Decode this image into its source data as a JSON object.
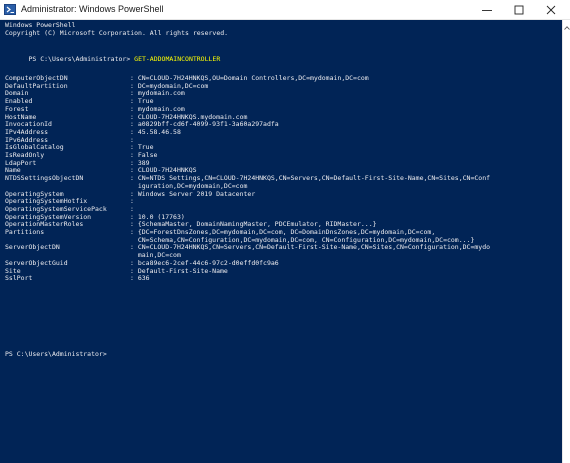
{
  "window": {
    "title": "Administrator: Windows PowerShell",
    "minimize_glyph": "—",
    "maximize_glyph": "☐",
    "close_glyph": "✕"
  },
  "console": {
    "banner_line1": "Windows PowerShell",
    "banner_line2": "Copyright (C) Microsoft Corporation. All rights reserved.",
    "prompt1": "PS C:\\Users\\Administrator> ",
    "command": "GET-ADDOMAINCONTROLLER",
    "properties": [
      {
        "key": "ComputerObjectDN",
        "value": ": CN=CLOUD-7H24HNKQS,OU=Domain Controllers,DC=mydomain,DC=com"
      },
      {
        "key": "DefaultPartition",
        "value": ": DC=mydomain,DC=com"
      },
      {
        "key": "Domain",
        "value": ": mydomain.com"
      },
      {
        "key": "Enabled",
        "value": ": True"
      },
      {
        "key": "Forest",
        "value": ": mydomain.com"
      },
      {
        "key": "HostName",
        "value": ": CLOUD-7H24HNKQS.mydomain.com"
      },
      {
        "key": "InvocationId",
        "value": ": a0829bff-cd6f-4099-93f1-3a60a297adfa"
      },
      {
        "key": "IPv4Address",
        "value": ": 45.58.46.58"
      },
      {
        "key": "IPv6Address",
        "value": ":"
      },
      {
        "key": "IsGlobalCatalog",
        "value": ": True"
      },
      {
        "key": "IsReadOnly",
        "value": ": False"
      },
      {
        "key": "LdapPort",
        "value": ": 389"
      },
      {
        "key": "Name",
        "value": ": CLOUD-7H24HNKQS"
      },
      {
        "key": "NTDSSettingsObjectDN",
        "value": ": CN=NTDS Settings,CN=CLOUD-7H24HNKQS,CN=Servers,CN=Default-First-Site-Name,CN=Sites,CN=Conf"
      },
      {
        "key": "",
        "value": "  iguration,DC=mydomain,DC=com"
      },
      {
        "key": "OperatingSystem",
        "value": ": Windows Server 2019 Datacenter"
      },
      {
        "key": "OperatingSystemHotfix",
        "value": ":"
      },
      {
        "key": "OperatingSystemServicePack",
        "value": ":"
      },
      {
        "key": "OperatingSystemVersion",
        "value": ": 10.0 (17763)"
      },
      {
        "key": "OperationMasterRoles",
        "value": ": {SchemaMaster, DomainNamingMaster, PDCEmulator, RIDMaster...}"
      },
      {
        "key": "Partitions",
        "value": ": {DC=ForestDnsZones,DC=mydomain,DC=com, DC=DomainDnsZones,DC=mydomain,DC=com,"
      },
      {
        "key": "",
        "value": "  CN=Schema,CN=Configuration,DC=mydomain,DC=com, CN=Configuration,DC=mydomain,DC=com...}"
      },
      {
        "key": "ServerObjectDN",
        "value": ": CN=CLOUD-7H24HNKQS,CN=Servers,CN=Default-First-Site-Name,CN=Sites,CN=Configuration,DC=mydo"
      },
      {
        "key": "",
        "value": "  main,DC=com"
      },
      {
        "key": "ServerObjectGuid",
        "value": ": bca89ec6-2cef-44c6-97c2-d0effd0fc9a6"
      },
      {
        "key": "Site",
        "value": ": Default-First-Site-Name"
      },
      {
        "key": "SslPort",
        "value": ": 636"
      }
    ],
    "prompt2": "PS C:\\Users\\Administrator>"
  },
  "colors": {
    "console_bg": "#012456",
    "console_fg": "#eeedf0",
    "command_fg": "#ffff00"
  }
}
